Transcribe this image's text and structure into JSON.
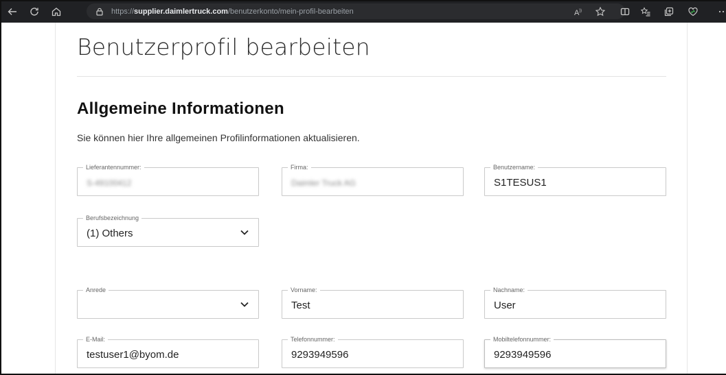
{
  "browser": {
    "url_prefix": "https://",
    "url_domain": "supplier.daimlertruck.com",
    "url_path": "/benutzerkonto/mein-profil-bearbeiten"
  },
  "page": {
    "title": "Benutzerprofil bearbeiten",
    "section_title": "Allgemeine Informationen",
    "section_desc": "Sie können hier Ihre allgemeinen Profilinformationen aktualisieren."
  },
  "fields": {
    "lieferantennummer": {
      "label": "Lieferantennummer:",
      "value": "S-49100412"
    },
    "firma": {
      "label": "Firma:",
      "value": "Daimler Truck AG"
    },
    "benutzername": {
      "label": "Benutzername:",
      "value": "S1TESUS1"
    },
    "berufsbezeichnung": {
      "label": "Berufsbezeichnung",
      "value": "(1) Others"
    },
    "anrede": {
      "label": "Anrede",
      "value": ""
    },
    "vorname": {
      "label": "Vorname:",
      "value": "Test"
    },
    "nachname": {
      "label": "Nachname:",
      "value": "User"
    },
    "email": {
      "label": "E-Mail:",
      "value": "testuser1@byom.de"
    },
    "telefon": {
      "label": "Telefonnummer:",
      "value": "9293949596"
    },
    "mobil": {
      "label": "Mobiltelefonnummer:",
      "value": "9293949596"
    }
  },
  "icons": {
    "back": "back-arrow-icon",
    "refresh": "refresh-icon",
    "home": "home-icon",
    "lock": "lock-icon",
    "read_aloud": "read-aloud-icon",
    "favorite": "star-icon",
    "split": "split-screen-icon",
    "favorites_bar": "favorites-icon",
    "collections": "collections-icon",
    "heart": "heart-icon",
    "chevron": "chevron-down-icon"
  }
}
